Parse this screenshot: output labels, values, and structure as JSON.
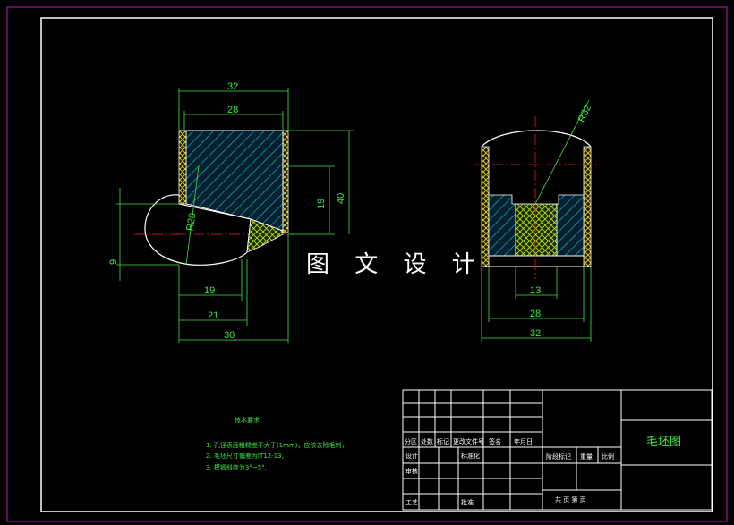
{
  "watermark": "图 文 设 计",
  "left_view": {
    "dims": {
      "d32": "32",
      "d28": "28",
      "d19v": "19",
      "d40": "40",
      "r20": "R20",
      "d9": "9",
      "d19h": "19",
      "d21": "21",
      "d30": "30"
    }
  },
  "right_view": {
    "dims": {
      "r32": "R32",
      "d13": "13",
      "d28": "28",
      "d32": "32"
    }
  },
  "notes": {
    "heading": "技术要求",
    "lines": [
      "1. 孔径表面粗糙度不大于(1mm)，应该去除毛刺，",
      "2. 毛坯尺寸偏差为IT12-13,",
      "3. 模锻斜度为3°~5°."
    ]
  },
  "title_block": {
    "drawing_title": "毛坯图",
    "labels": {
      "fenqu": "分区",
      "chuangshu": "处数",
      "biaoji": "标记",
      "gengdong": "更改文件号",
      "qianming": "签名",
      "nianyueri": "年月日",
      "sheji": "设计",
      "biaozhunhua": "标准化",
      "shenhe": "审核",
      "gongyi": "工艺",
      "pizhun": "批准",
      "jieduan": "阶段标记",
      "zhongliang": "重量",
      "bili": "比例",
      "sheets": "共  页 第  页"
    }
  }
}
